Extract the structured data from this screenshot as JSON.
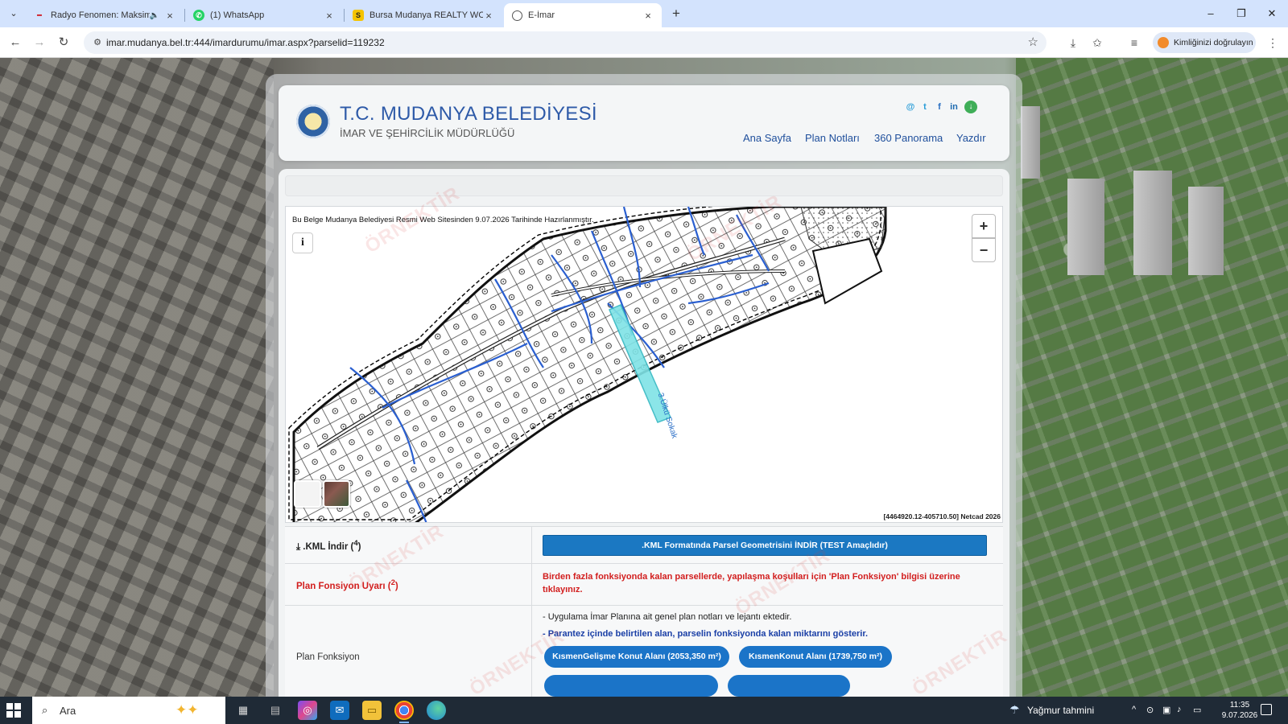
{
  "browser": {
    "tabs": [
      {
        "title": "Radyo Fenomen: Maksimum",
        "favicon": "radio-icon",
        "audio": true
      },
      {
        "title": "(1) WhatsApp",
        "favicon": "whatsapp-icon"
      },
      {
        "title": "Bursa Mudanya REALTY WORLD",
        "favicon": "s-icon"
      },
      {
        "title": "E-İmar",
        "favicon": "globe-icon",
        "active": true
      }
    ],
    "url": "imar.mudanya.bel.tr:444/imardurumu/imar.aspx?parselid=119232",
    "profile_label": "Kimliğinizi doğrulayın"
  },
  "header": {
    "title": "T.C. MUDANYA BELEDİYESİ",
    "subtitle": "İMAR VE ŞEHİRCİLİK MÜDÜRLÜĞÜ",
    "social": [
      "@",
      "t",
      "f",
      "in",
      "↓"
    ],
    "nav": [
      "Ana Sayfa",
      "Plan Notları",
      "360 Panorama",
      "Yazdır"
    ]
  },
  "map": {
    "note": "Bu Belge Mudanya Belediyesi Resmi Web Sitesinden 9.07.2026 Tarihinde Hazırlanmıştır.",
    "info_button": "i",
    "zoom_in": "+",
    "zoom_out": "−",
    "street_label": "3.Ülkü Sokak",
    "coords": "[4464920.12-405710.50] Netcad 2026"
  },
  "rows": {
    "kml": {
      "label": ".KML İndir (",
      "sup": "4",
      "label_end": ")",
      "button": ".KML Formatında Parsel Geometrisini İNDİR (TEST Amaçlıdır)"
    },
    "warning": {
      "label": "Plan Fonsiyon Uyarı (",
      "sup": "2",
      "label_end": ")",
      "text": "Birden fazla fonksiyonda kalan parsellerde, yapılaşma koşulları için 'Plan Fonksiyon' bilgisi üzerine tıklayınız."
    },
    "function": {
      "label": "Plan Fonksiyon",
      "note1": "- Uygulama İmar Planına ait genel plan notları ve lejantı ektedir.",
      "note2": "- Parantez içinde belirtilen alan, parselin fonksiyonda kalan miktarını gösterir.",
      "pills": [
        "KısmenGelişme Konut Alanı (2053,350 m²)",
        "KısmenKonut Alanı (1739,750 m²)"
      ]
    }
  },
  "watermark": "ÖRNEKTİR",
  "taskbar": {
    "search_placeholder": "Ara",
    "weather": "Yağmur tahmini",
    "time": "11:35",
    "date": "9.07.2026"
  },
  "colors": {
    "brand_blue": "#2e5aa8",
    "button_blue": "#1b78c2",
    "warning_red": "#d21e1e"
  }
}
